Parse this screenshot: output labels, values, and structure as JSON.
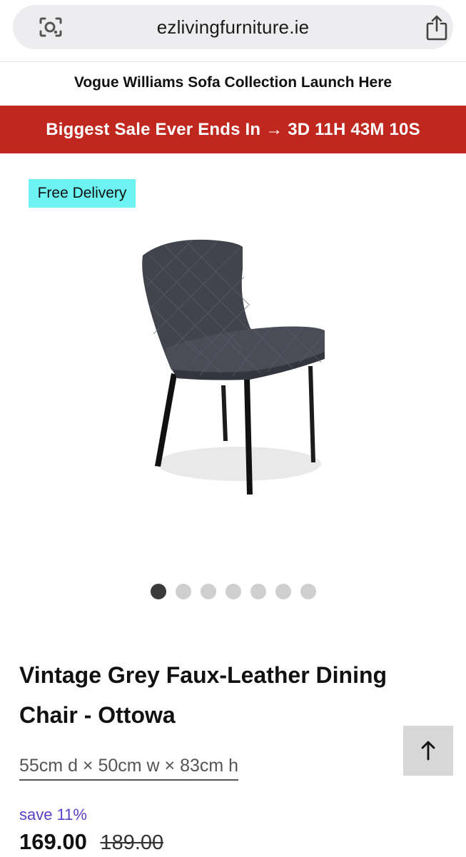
{
  "browser": {
    "url": "ezlivingfurniture.ie",
    "lens_icon": "camera-search-icon",
    "share_icon": "share-icon"
  },
  "promo": {
    "text": "Vogue Williams Sofa Collection Launch Here"
  },
  "sale_banner": {
    "text": "Biggest Sale Ever Ends In → 3D 11H 43M 10S",
    "color": "#c0271f"
  },
  "product": {
    "badge": "Free Delivery",
    "badge_color": "#6ef3f3",
    "image_icon": "dining-chair-image",
    "carousel": {
      "count": 7,
      "active_index": 0
    },
    "title": "Vintage Grey Faux-Leather Dining Chair - Ottowa",
    "dimensions": "55cm d × 50cm w × 83cm h",
    "save": "save 11%",
    "price": "169.00",
    "old_price": "189.00"
  },
  "back_to_top": {
    "icon": "arrow-up-icon"
  }
}
